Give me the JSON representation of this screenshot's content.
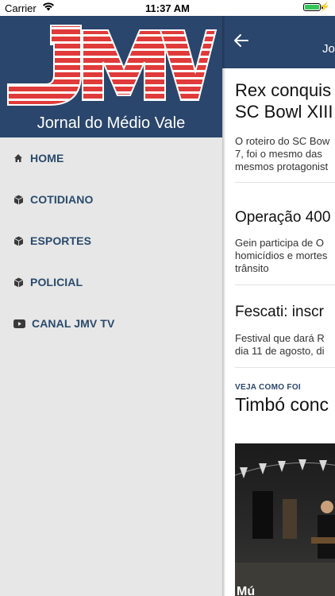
{
  "status_bar": {
    "carrier": "Carrier",
    "time": "11:37 AM",
    "icons": [
      "wifi-icon",
      "battery-icon",
      "charging-bolt-icon"
    ],
    "battery_color": "#34c759"
  },
  "drawer": {
    "logo_text": "JMV",
    "logo_caption": "Jornal do Médio Vale",
    "header_color": "#2b466c",
    "logo_color": "#e03a3a",
    "items": [
      {
        "label": "HOME",
        "icon": "home-icon"
      },
      {
        "label": "COTIDIANO",
        "icon": "cube-icon"
      },
      {
        "label": "ESPORTES",
        "icon": "cube-icon"
      },
      {
        "label": "POLICIAL",
        "icon": "cube-icon"
      },
      {
        "label": "CANAL JMV TV",
        "icon": "youtube-icon"
      }
    ]
  },
  "main": {
    "appbar_title": "Jo",
    "back_icon": "back-arrow-icon",
    "articles": [
      {
        "title_lines": [
          "Rex conquis",
          "SC Bowl XIII"
        ],
        "text_lines": [
          "O roteiro do SC Bow",
          "7, foi o mesmo das",
          "mesmos protagonist"
        ]
      },
      {
        "title": "Operação 400",
        "text_lines": [
          "Gein participa de O",
          "homicídios e mortes",
          "trânsito"
        ]
      },
      {
        "title": "Fescati: inscr",
        "text_lines": [
          "Festival que dará R",
          "dia 11 de agosto, di"
        ]
      }
    ],
    "feature": {
      "kicker": "VEJA COMO FOI",
      "title": "Timbó conc",
      "photo_caption": "Mú"
    }
  }
}
